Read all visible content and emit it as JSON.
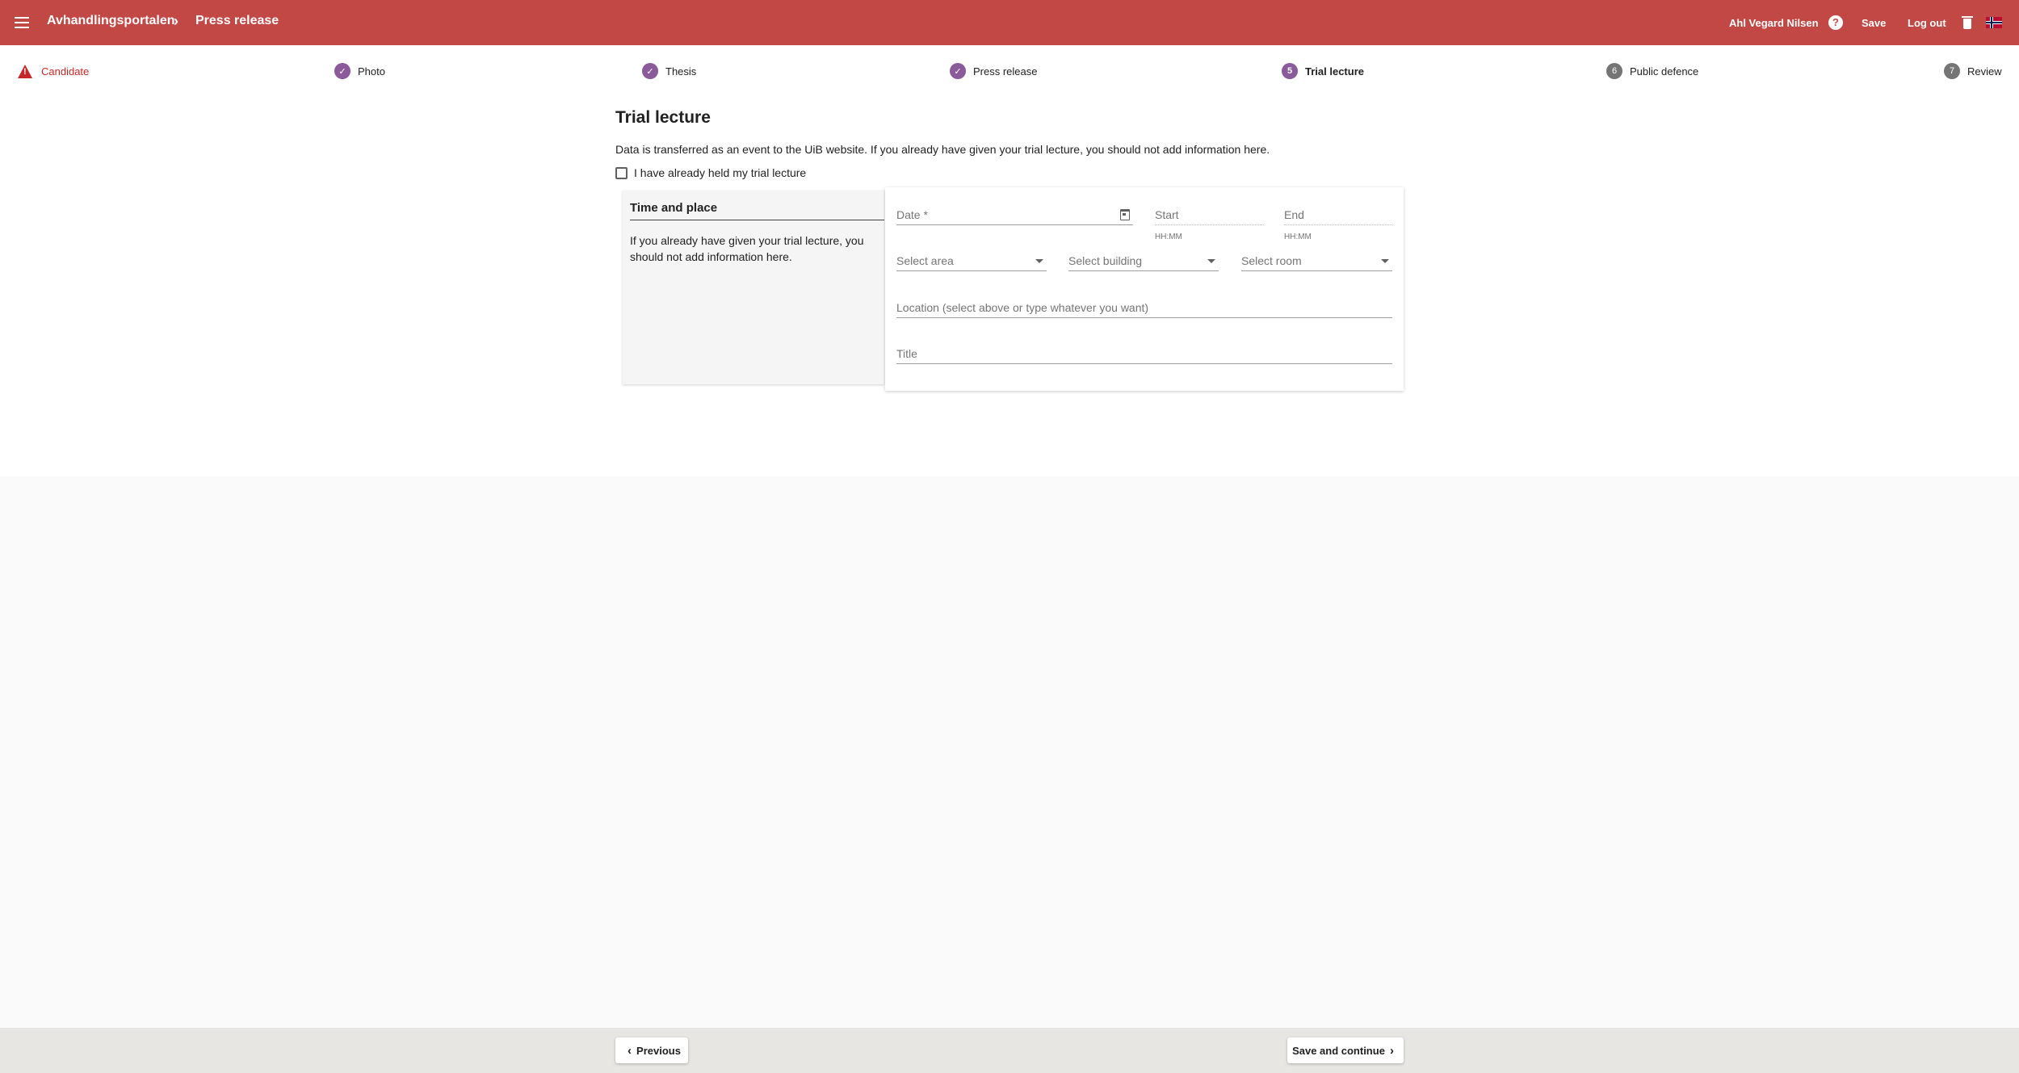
{
  "header": {
    "app_name": "Avhandlingsportalen",
    "breadcrumb_separator": "›",
    "current_page": "Press release",
    "user_name": "Ahl Vegard Nilsen",
    "help_icon": "?",
    "save_label": "Save",
    "logout_label": "Log out",
    "brand_color": "#c14845"
  },
  "stepper": {
    "steps": [
      {
        "label": "Candidate",
        "state": "error",
        "marker": ""
      },
      {
        "label": "Photo",
        "state": "done",
        "marker": "✓"
      },
      {
        "label": "Thesis",
        "state": "done",
        "marker": "✓"
      },
      {
        "label": "Press release",
        "state": "done",
        "marker": "✓"
      },
      {
        "label": "Trial lecture",
        "state": "active",
        "marker": "5"
      },
      {
        "label": "Public defence",
        "state": "todo",
        "marker": "6"
      },
      {
        "label": "Review",
        "state": "todo",
        "marker": "7"
      }
    ]
  },
  "main": {
    "title": "Trial lecture",
    "intro": "Data is transferred as an event to the UiB website. If you already have given your trial lecture, you should not add information here.",
    "checkbox_label": "I have already held my trial lecture",
    "checkbox_checked": false
  },
  "side_panel": {
    "title": "Time and place",
    "text": "If you already have given your trial lecture, you should not add information here."
  },
  "form": {
    "date_placeholder": "Date *",
    "start_placeholder": "Start",
    "start_hint": "HH:MM",
    "end_placeholder": "End",
    "end_hint": "HH:MM",
    "area_placeholder": "Select area",
    "building_placeholder": "Select building",
    "room_placeholder": "Select room",
    "location_placeholder": "Location (select above or type whatever you want)",
    "title_placeholder": "Title"
  },
  "footer": {
    "previous_label": "Previous",
    "next_label": "Save and continue"
  }
}
